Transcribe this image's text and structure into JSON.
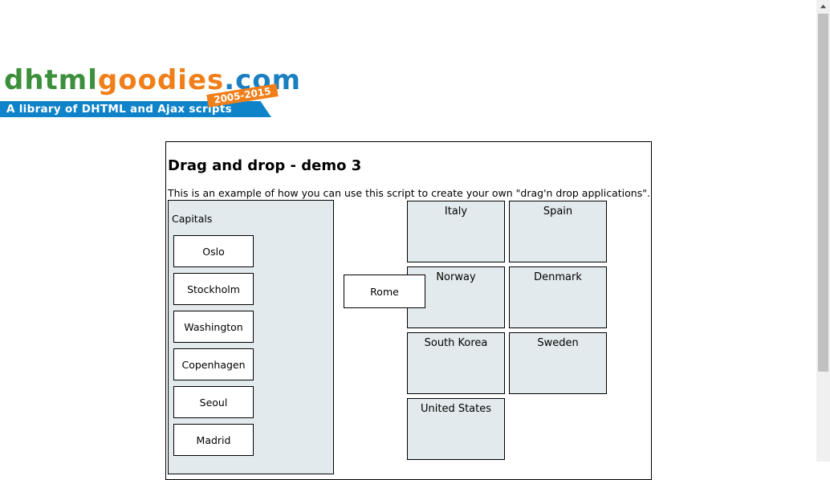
{
  "logo": {
    "part1": "dhtml",
    "part2": "goodies",
    "part3": ".com",
    "years": "2005-2015",
    "tagline": "A library of DHTML and Ajax scripts"
  },
  "demo": {
    "title": "Drag and drop - demo 3",
    "intro": "This is an example of how you can use this script to create your own \"drag'n drop applications\".",
    "capitals_label": "Capitals",
    "capitals": [
      "Oslo",
      "Stockholm",
      "Washington",
      "Copenhagen",
      "Seoul",
      "Madrid"
    ],
    "dragging": "Rome",
    "countries": [
      "Italy",
      "Spain",
      "Norway",
      "Denmark",
      "South Korea",
      "Sweden",
      "United States"
    ]
  },
  "colors": {
    "drop_bg": "#e2eaed",
    "logo_green": "#3c8f3b",
    "logo_orange": "#f07f1a",
    "logo_blue": "#1a7fc1"
  }
}
